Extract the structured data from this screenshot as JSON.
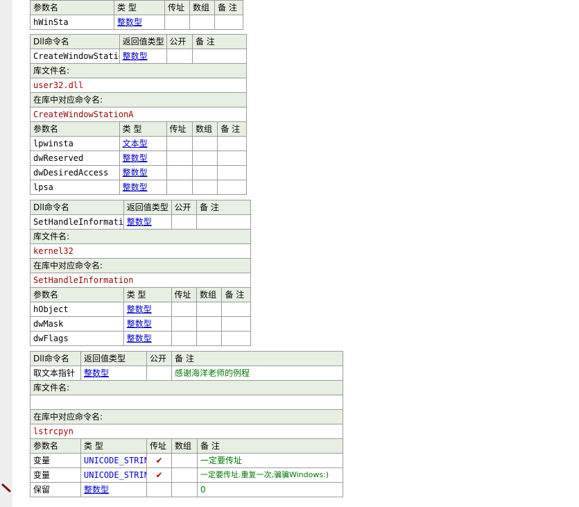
{
  "headers": {
    "param": "参数名",
    "type": "类 型",
    "byref": "传址",
    "array": "数组",
    "note": "备 注",
    "dll_cmd": "Dll命令名",
    "return_type": "返回值类型",
    "public": "公开",
    "lib_file": "库文件名:",
    "lib_cmd": "在库中对应命令名:"
  },
  "top_fragment": {
    "params": [
      {
        "name": "hWinSta",
        "type": "整数型"
      }
    ]
  },
  "dll1": {
    "name": "CreateWindowStation",
    "return_type": "整数型",
    "lib": "user32.dll",
    "lib_cmd": "CreateWindowStationA",
    "params": [
      {
        "name": "lpwinsta",
        "type": "文本型"
      },
      {
        "name": "dwReserved",
        "type": "整数型"
      },
      {
        "name": "dwDesiredAccess",
        "type": "整数型"
      },
      {
        "name": "lpsa",
        "type": "整数型"
      }
    ]
  },
  "dll2": {
    "name": "SetHandleInformation",
    "return_type": "整数型",
    "lib": "kernel32",
    "lib_cmd": "SetHandleInformation",
    "params": [
      {
        "name": "hObject",
        "type": "整数型"
      },
      {
        "name": "dwMask",
        "type": "整数型"
      },
      {
        "name": "dwFlags",
        "type": "整数型"
      }
    ]
  },
  "dll3": {
    "name": "取文本指针",
    "return_type": "整数型",
    "note": "感谢海洋老师的例程",
    "lib": "",
    "lib_cmd": "lstrcpyn",
    "params": [
      {
        "name": "变量",
        "type": "UNICODE_STRING",
        "byref": "✔",
        "note": "一定要传址"
      },
      {
        "name": "变量",
        "type": "UNICODE_STRING",
        "byref": "✔",
        "note": "一定要传址.重复一次,骗骗Windows:)"
      },
      {
        "name": "保留",
        "type": "整数型",
        "byref": "",
        "note": "0"
      }
    ]
  },
  "icons": {
    "gutter_marker": "pencil-icon"
  }
}
